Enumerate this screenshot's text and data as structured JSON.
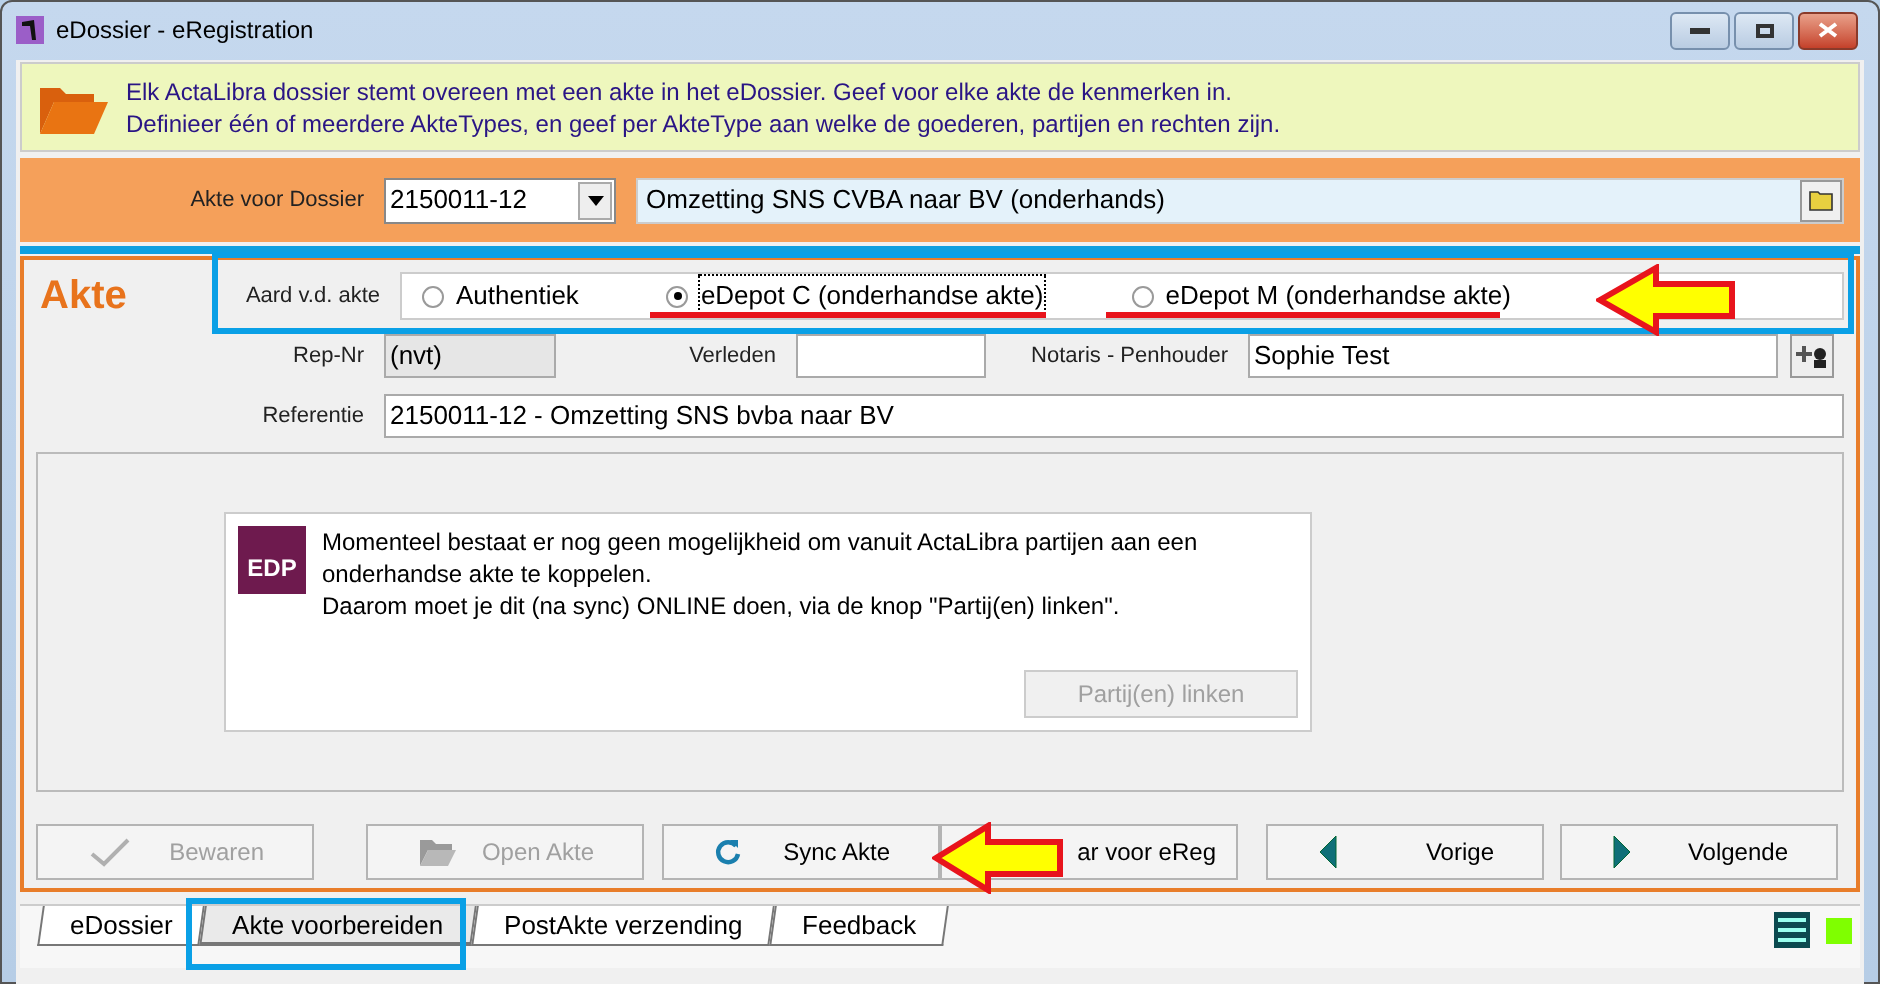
{
  "window": {
    "title": "eDossier - eRegistration"
  },
  "info_banner": {
    "lines": [
      "Elk ActaLibra dossier stemt overeen met een akte in het eDossier. Geef voor elke akte de kenmerken in.",
      "Definieer één of meerdere AkteTypes, en geef per AkteType aan welke de goederen, partijen en rechten zijn."
    ]
  },
  "dossier": {
    "label": "Akte voor Dossier",
    "number": "2150011-12",
    "description": "Omzetting SNS CVBA naar BV (onderhands)"
  },
  "akte": {
    "title": "Akte",
    "aard_label": "Aard v.d. akte",
    "options": [
      {
        "label": "Authentiek",
        "selected": false
      },
      {
        "label": "eDepot C (onderhandse akte)",
        "selected": true
      },
      {
        "label": "eDepot M (onderhandse akte)",
        "selected": false
      }
    ],
    "rep_nr": {
      "label": "Rep-Nr",
      "value": "(nvt)"
    },
    "verleden": {
      "label": "Verleden"
    },
    "notaris": {
      "label": "Notaris - Penhouder",
      "value": "Sophie Test"
    },
    "referentie": {
      "label": "Referentie",
      "value": "2150011-12 - Omzetting SNS bvba naar BV"
    }
  },
  "message": {
    "logo": "EDP",
    "lines": [
      "Momenteel bestaat er nog geen mogelijkheid om vanuit ActaLibra partijen aan een onderhandse akte te koppelen.",
      "Daarom moet je dit (na sync) ONLINE doen, via de knop \"Partij(en) linken\"."
    ],
    "button": {
      "label": "Partij(en) linken",
      "disabled": true
    }
  },
  "buttons": [
    {
      "kind": "check",
      "label": "Bewaren",
      "disabled": true
    },
    {
      "kind": "folder",
      "label": "Open Akte",
      "disabled": true
    },
    {
      "kind": "sync",
      "label": "Sync Akte",
      "disabled": false
    },
    {
      "kind": "plain",
      "label": "ar voor eReg",
      "disabled": false
    },
    {
      "kind": "prev",
      "label": "Vorige",
      "disabled": false
    },
    {
      "kind": "next",
      "label": "Volgende",
      "disabled": false
    }
  ],
  "tabs": [
    {
      "label": "eDossier",
      "selected": false
    },
    {
      "label": "Akte voorbereiden",
      "selected": true
    },
    {
      "label": "PostAkte verzending",
      "selected": false
    },
    {
      "label": "Feedback",
      "selected": false
    }
  ]
}
